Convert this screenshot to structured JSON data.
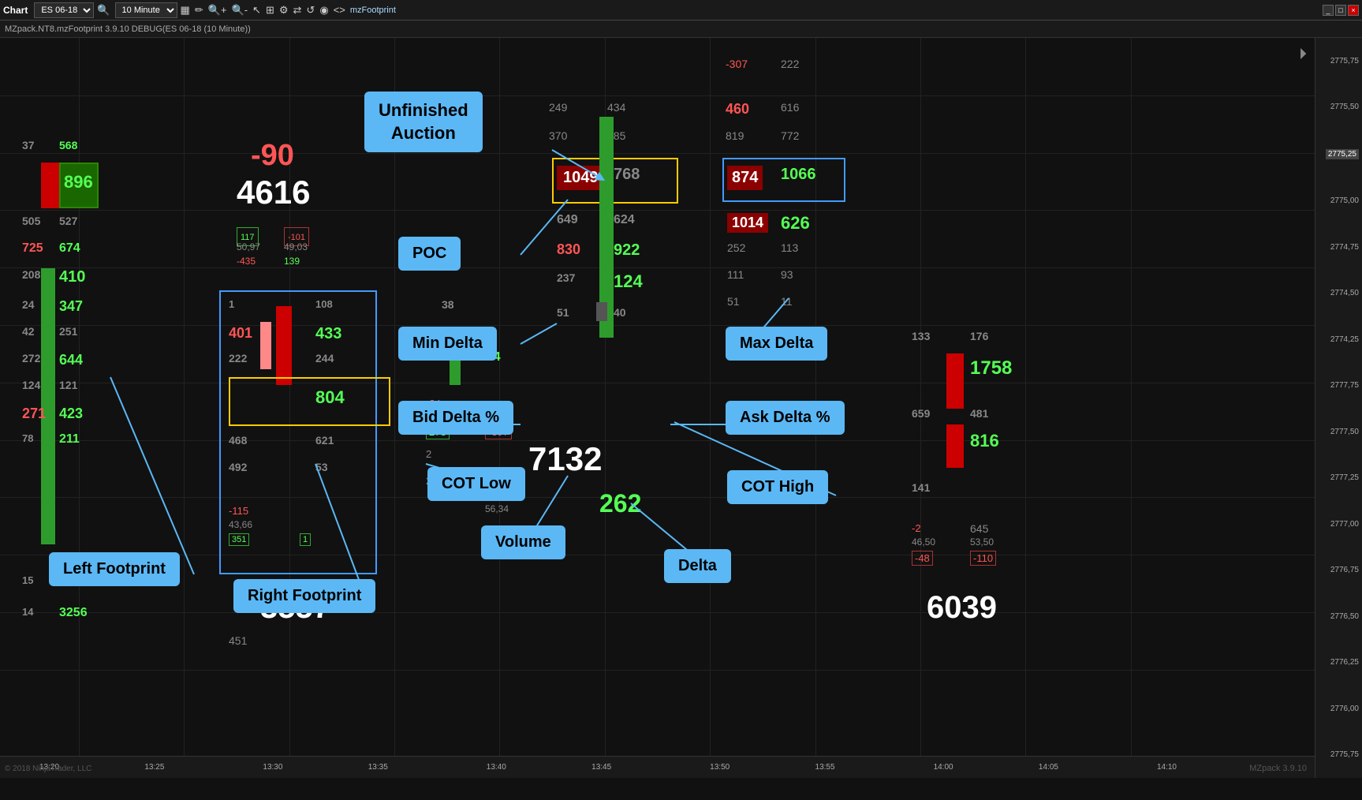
{
  "titlebar": {
    "label": "Chart",
    "instrument": "ES 06-18",
    "timeframe": "10 Minute",
    "plugin": "mzFootprint",
    "window_buttons": [
      "_",
      "□",
      "×"
    ]
  },
  "infobar": {
    "text": "MZpack.NT8.mzFootprint 3.9.10 DEBUG(ES 06-18 (10 Minute))"
  },
  "price_scale": {
    "ticks": [
      "2775,25",
      "2774,25",
      "2774,50",
      "2774,75",
      "2775,00",
      "2775,25",
      "2775,50",
      "2775,75",
      "2776,00",
      "2776,25",
      "2776,50",
      "2776,75",
      "2777,00",
      "2777,25",
      "2777,50",
      "2777,75"
    ]
  },
  "time_axis": {
    "labels": [
      "13:20",
      "13:25",
      "13:30",
      "13:35",
      "13:40",
      "13:45",
      "13:50",
      "13:55",
      "14:00",
      "14:05",
      "14:10"
    ]
  },
  "annotations": {
    "unfinished_auction": "Unfinished\nAuction",
    "poc": "POC",
    "min_delta": "Min Delta",
    "bid_delta_pct": "Bid Delta %",
    "ask_delta_pct": "Ask Delta %",
    "max_delta": "Max Delta",
    "cot_low": "COT Low",
    "cot_high": "COT High",
    "volume": "Volume",
    "delta": "Delta",
    "left_footprint": "Left Footprint",
    "right_footprint": "Right Footprint"
  },
  "chart_numbers": {
    "delta_top": "-90",
    "price_main": "4616",
    "volume_main": "7132",
    "volume2": "3557",
    "volume3": "6039",
    "delta_bottom": "262"
  },
  "watermark": "MZpack 3.9.10",
  "copyright": "© 2018 NinjaTrader, LLC"
}
